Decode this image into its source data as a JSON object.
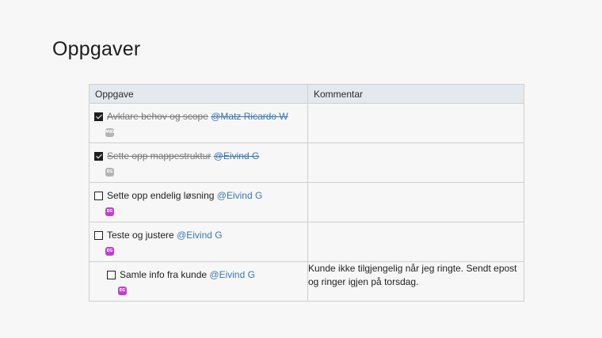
{
  "page": {
    "title": "Oppgaver"
  },
  "table": {
    "headers": {
      "task": "Oppgave",
      "comment": "Kommentar"
    },
    "rows": [
      {
        "done": true,
        "indent": false,
        "text": "Avklare behov og scope",
        "mention": "@Matz Ricardo W",
        "avatar": "MRW",
        "avatar_color": "#b5b5b5",
        "comment": ""
      },
      {
        "done": true,
        "indent": false,
        "text": "Sette opp mappestruktur",
        "mention": "@Eivind G",
        "avatar": "EG",
        "avatar_color": "#b5b5b5",
        "comment": ""
      },
      {
        "done": false,
        "indent": false,
        "text": "Sette opp endelig løsning",
        "mention": "@Eivind G",
        "avatar": "EG",
        "avatar_color": "#c23fd1",
        "comment": ""
      },
      {
        "done": false,
        "indent": false,
        "text": "Teste og justere",
        "mention": "@Eivind G",
        "avatar": "EG",
        "avatar_color": "#c23fd1",
        "comment": ""
      },
      {
        "done": false,
        "indent": true,
        "text": "Samle info fra kunde",
        "mention": "@Eivind G",
        "avatar": "EG",
        "avatar_color": "#c23fd1",
        "comment": "Kunde ikke tilgjengelig når jeg ringte. Sendt epost og ringer igjen på torsdag."
      }
    ]
  },
  "colors": {
    "mention": "#3a78b5",
    "header_bg": "#e4e8ef",
    "active_avatar": "#c23fd1",
    "done_avatar": "#b5b5b5"
  }
}
